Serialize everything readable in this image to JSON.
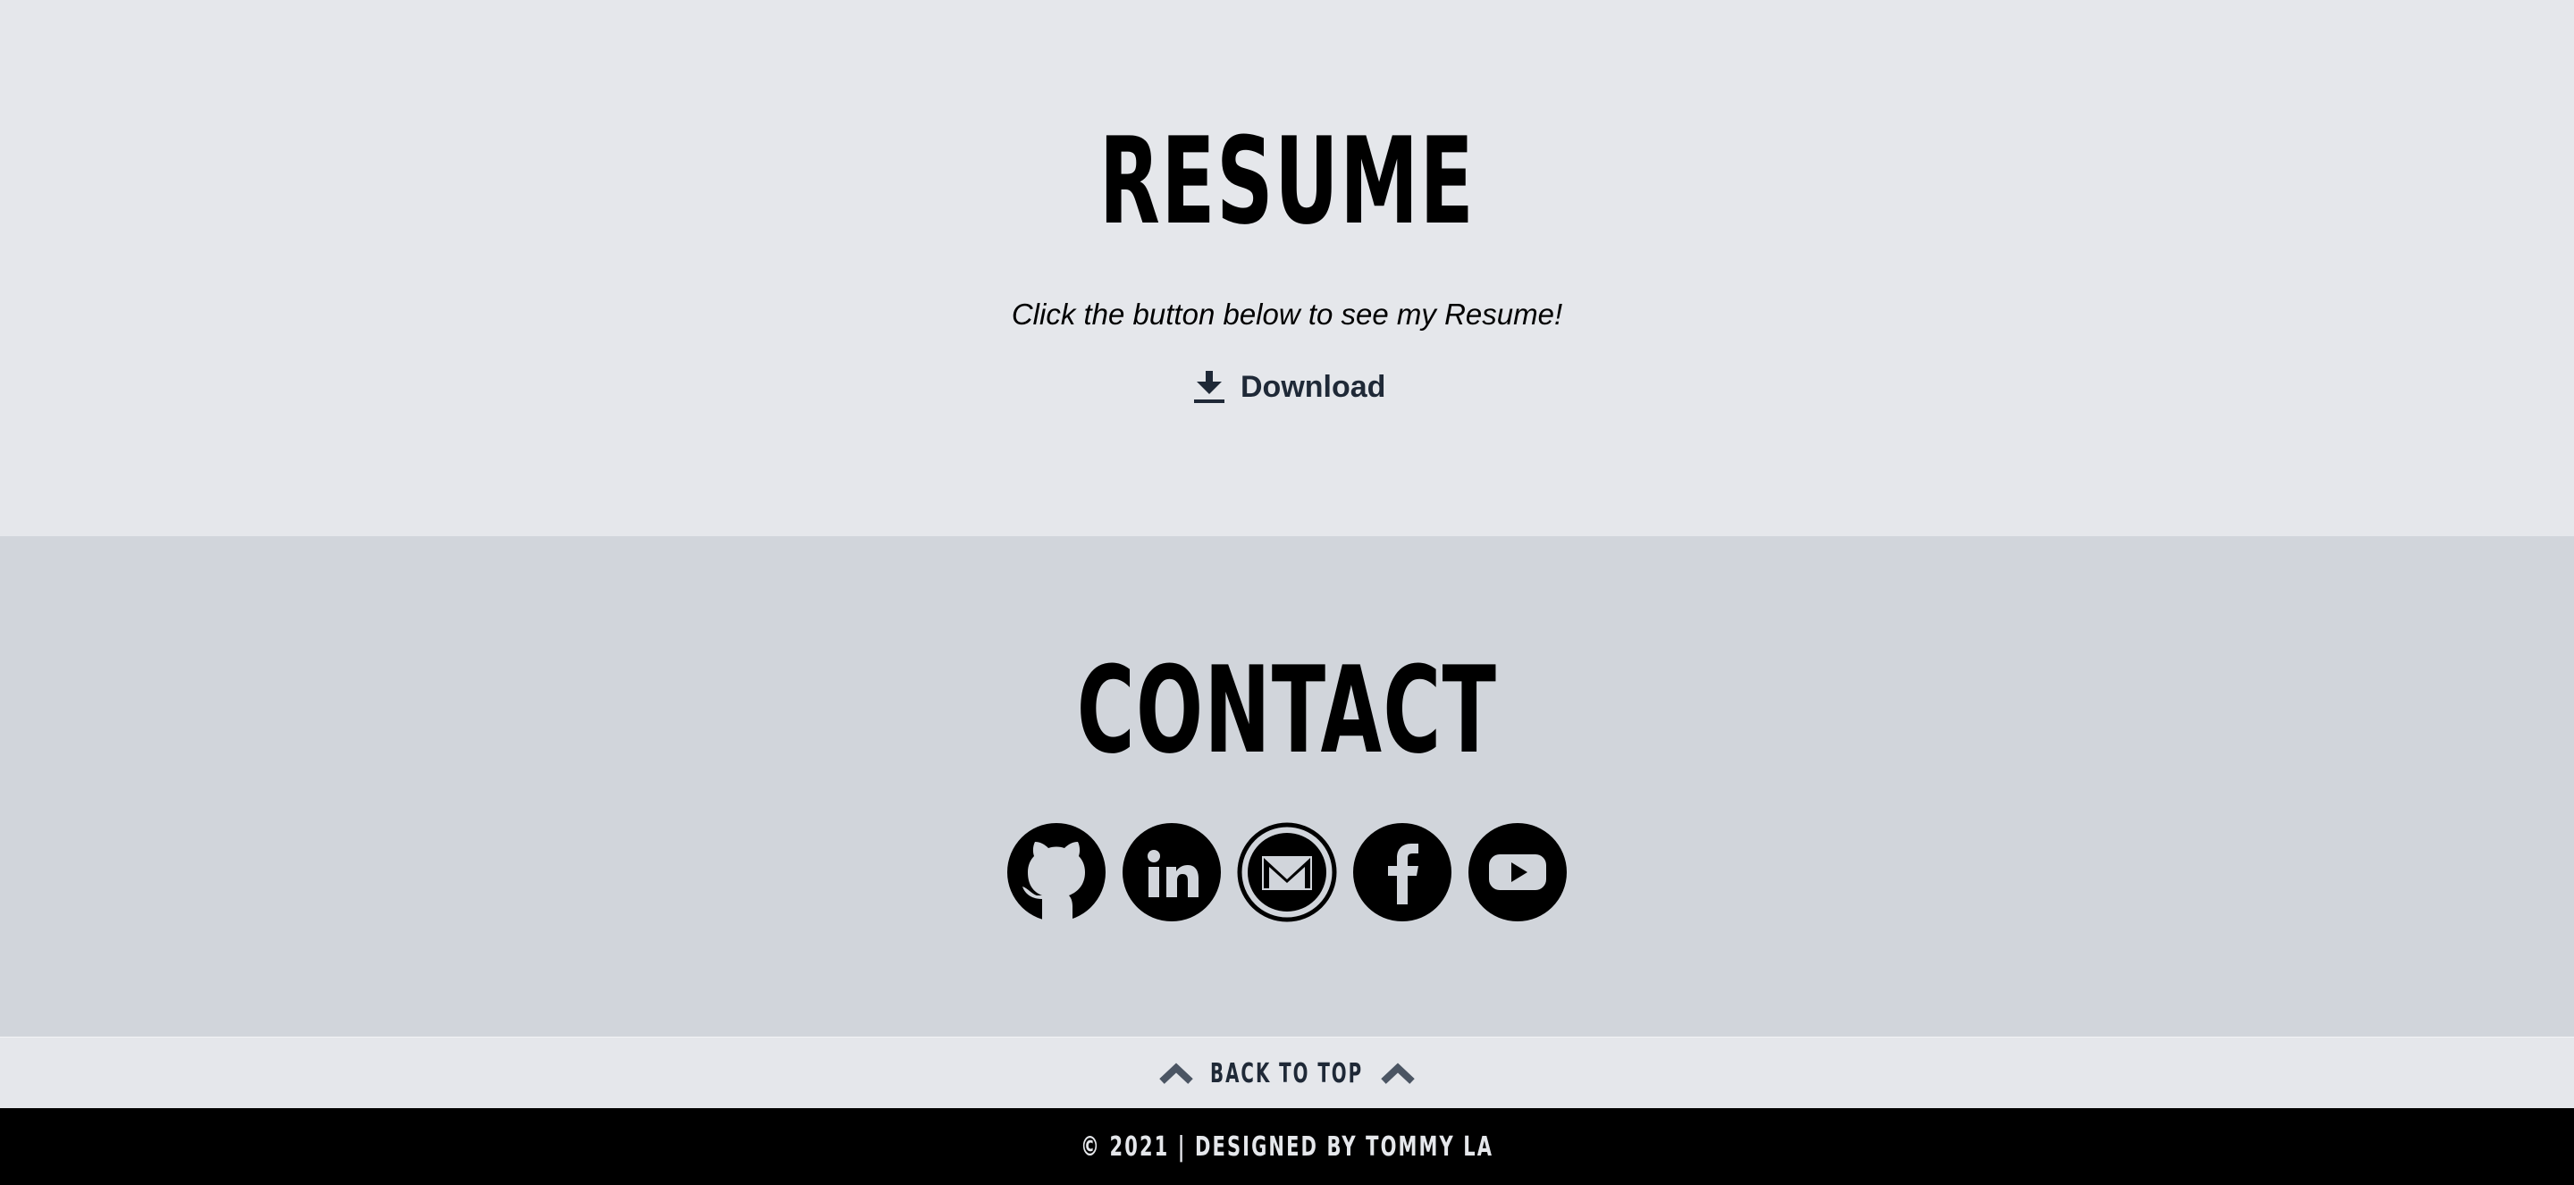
{
  "resume": {
    "title": "RESUME",
    "subtitle": "Click the button below to see my Resume!",
    "download_label": "Download",
    "download_icon": "download-icon"
  },
  "contact": {
    "title": "CONTACT",
    "links": [
      {
        "name": "github",
        "icon": "github-icon"
      },
      {
        "name": "linkedin",
        "icon": "linkedin-icon"
      },
      {
        "name": "gmail",
        "icon": "gmail-icon"
      },
      {
        "name": "facebook",
        "icon": "facebook-icon"
      },
      {
        "name": "youtube",
        "icon": "youtube-icon"
      }
    ]
  },
  "back_to_top": {
    "label": "BACK TO TOP",
    "icon": "chevron-up-icon"
  },
  "footer": {
    "text": "© 2021 | DESIGNED BY TOMMY LA"
  },
  "colors": {
    "resume_bg": "#e5e7eb",
    "contact_bg": "#d1d5db",
    "footer_bg": "#000000",
    "text_dark": "#1f2937"
  }
}
